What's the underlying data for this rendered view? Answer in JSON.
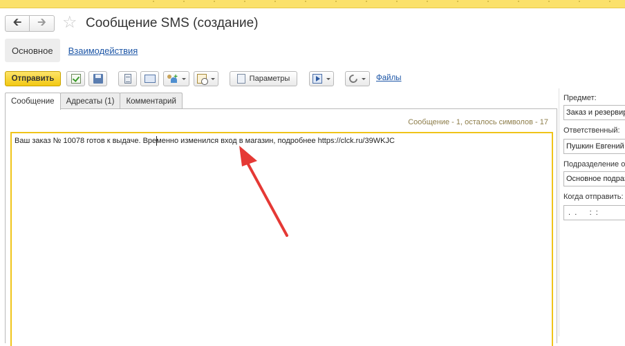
{
  "window": {
    "title": "Сообщение SMS (создание)"
  },
  "sections": {
    "active": "Основное",
    "link": "Взаимодействия"
  },
  "toolbar": {
    "send_label": "Отправить",
    "params_label": "Параметры",
    "files_label": "Файлы"
  },
  "tabs": [
    {
      "label": "Сообщение",
      "active": true
    },
    {
      "label": "Адресаты (1)",
      "active": false
    },
    {
      "label": "Комментарий",
      "active": false
    }
  ],
  "message": {
    "counter": "Сообщение - 1, осталось символов - 17",
    "text": "Ваш заказ № 10078 готов к выдаче. Временно изменился вход в магазин, подробнее https://clck.ru/39WKJC"
  },
  "sidebar": {
    "subject_label": "Предмет:",
    "subject_value": "Заказ и резервир",
    "responsible_label": "Ответственный:",
    "responsible_value": "Пушкин Евгений",
    "department_label": "Подразделение от",
    "department_value": "Основное подраз",
    "when_label": "Когда отправить:",
    "when_value": " .  .      :  :"
  },
  "colors": {
    "accent_yellow": "#f2c812",
    "link_blue": "#1c55a6",
    "annotation_red": "#e53935"
  }
}
